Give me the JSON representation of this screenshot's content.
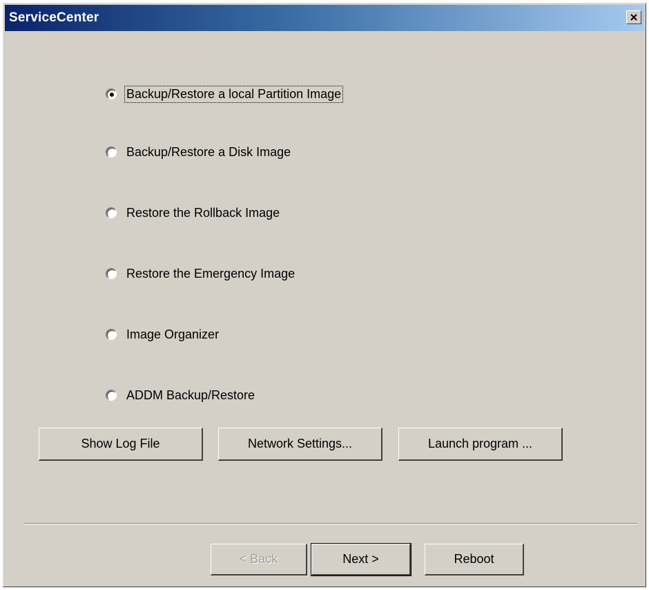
{
  "window": {
    "title": "ServiceCenter",
    "close_icon": "close-icon"
  },
  "options": {
    "selected_index": 0,
    "items": [
      {
        "label": "Backup/Restore a local Partition Image",
        "selected": true
      },
      {
        "label": "Backup/Restore a Disk Image",
        "selected": false
      },
      {
        "label": "Restore the Rollback Image",
        "selected": false
      },
      {
        "label": "Restore the Emergency Image",
        "selected": false
      },
      {
        "label": "Image Organizer",
        "selected": false
      },
      {
        "label": "ADDM Backup/Restore",
        "selected": false
      }
    ]
  },
  "tools": {
    "show_log_label": "Show Log File",
    "network_settings_label": "Network Settings...",
    "launch_program_label": "Launch program ..."
  },
  "nav": {
    "back_label": "< Back",
    "back_enabled": false,
    "next_label": "Next >",
    "reboot_label": "Reboot"
  }
}
